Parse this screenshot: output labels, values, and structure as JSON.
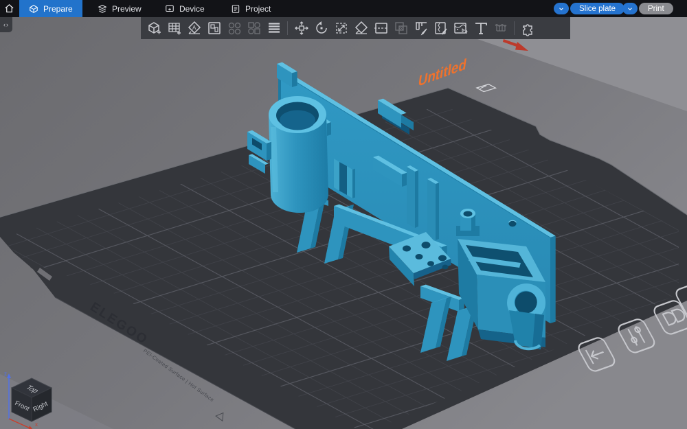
{
  "topbar": {
    "tabs": [
      {
        "label": "Prepare",
        "active": true
      },
      {
        "label": "Preview",
        "active": false
      },
      {
        "label": "Device",
        "active": false
      },
      {
        "label": "Project",
        "active": false
      }
    ],
    "slice_button": "Slice plate",
    "print_button": "Print"
  },
  "toolbar": {
    "icons": [
      "add-object",
      "add-plate",
      "auto-orient",
      "arrange",
      "split-to-objects",
      "split-to-parts",
      "variable-layer-height",
      "move",
      "rotate",
      "scale",
      "lay-on-face",
      "cut",
      "mesh-boolean",
      "support-paint",
      "seam-paint",
      "defect-inspect",
      "add-text",
      "fuzzy-skin",
      "assembly-view"
    ]
  },
  "viewport": {
    "plate_name": "Untitled",
    "brand": "ELEGOO",
    "surface_text": "PEI-Coated Surface | Hot Surface",
    "nav_cube": {
      "top": "Top",
      "front": "Front",
      "right": "Right"
    },
    "axes": {
      "x": "x",
      "z": "z"
    },
    "colors": {
      "accent": "#2573cf",
      "model_blue": "#2e94be",
      "label_orange": "#f0722c"
    }
  }
}
